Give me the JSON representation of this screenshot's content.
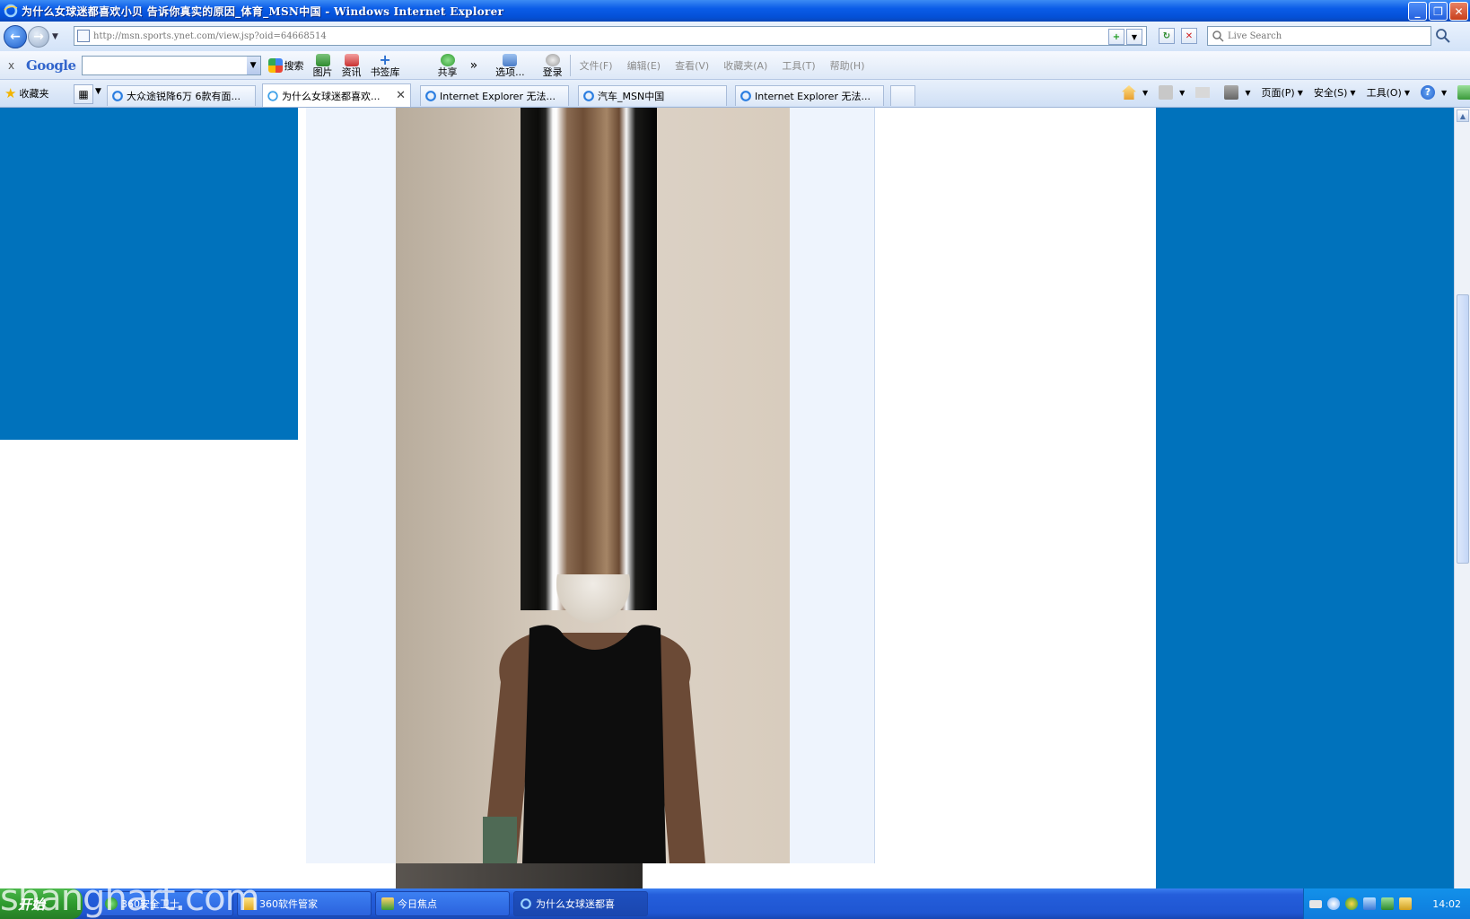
{
  "window": {
    "title": "为什么女球迷都喜欢小贝 告诉你真实的原因_体育_MSN中国 - Windows Internet Explorer",
    "buttons": [
      "_",
      "❐",
      "✕"
    ]
  },
  "address_bar": {
    "url": "http://msn.sports.ynet.com/view.jsp?oid=64668514",
    "search_placeholder": "Live Search"
  },
  "google_toolbar": {
    "close": "x",
    "logo": "Google",
    "search_label": "搜索",
    "images": "图片",
    "news": "资讯",
    "bookmarks": "书签库",
    "share": "共享",
    "more": "»",
    "options": "选项...",
    "login": "登录",
    "menus": [
      "文件(F)",
      "编辑(E)",
      "查看(V)",
      "收藏夹(A)",
      "工具(T)",
      "帮助(H)"
    ]
  },
  "tabs_bar": {
    "favorites": "收藏夹",
    "tabs": [
      {
        "label": "大众途锐降6万 6款有面..."
      },
      {
        "label": "为什么女球迷都喜欢..."
      },
      {
        "label": "Internet Explorer 无法..."
      },
      {
        "label": "汽车_MSN中国"
      },
      {
        "label": "Internet Explorer 无法..."
      }
    ],
    "commands": [
      "页面(P)",
      "安全(S)",
      "工具(O)"
    ]
  },
  "taskbar": {
    "start": "开始",
    "tasks": [
      "360安全卫士",
      "360软件管家",
      "今日焦点",
      "为什么女球迷都喜"
    ],
    "clock": "14:02"
  },
  "watermark": "shanghart.com",
  "colors": {
    "page_bg": "#0072bc",
    "title_bar": "#0a5ce8",
    "taskbar": "#245edb"
  }
}
